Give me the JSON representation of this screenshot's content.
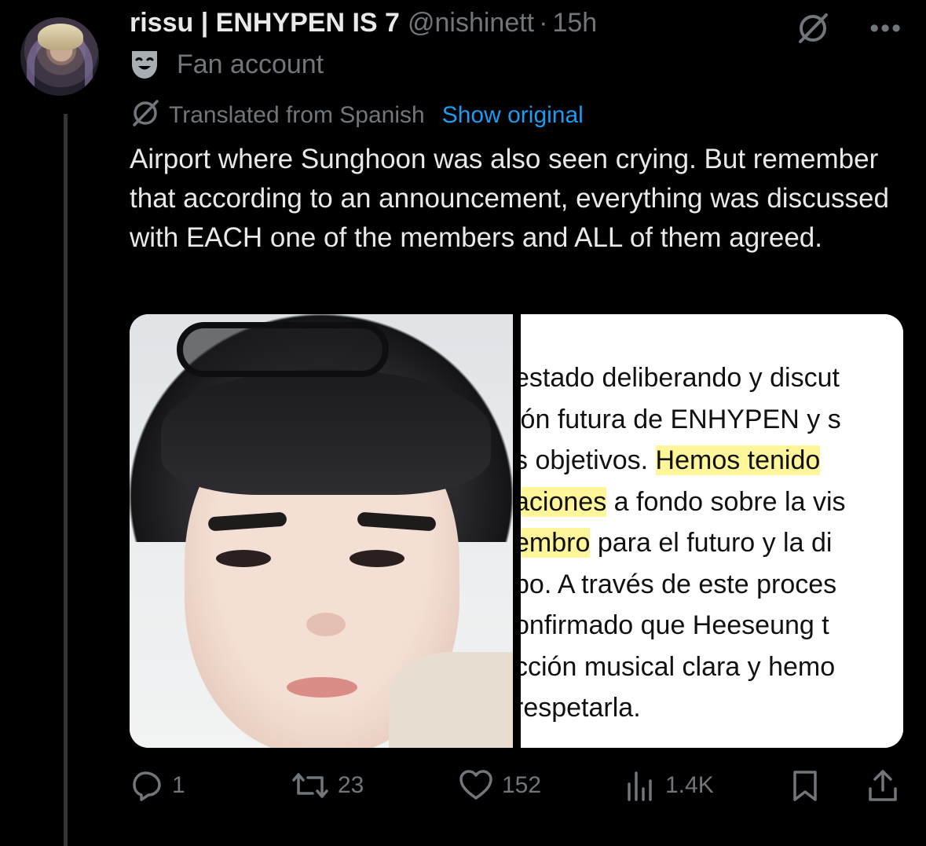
{
  "author": {
    "display_name": "rissu | ENHYPEN IS 7",
    "handle": "@nishinett",
    "separator": "·",
    "time": "15h",
    "label": "Fan account"
  },
  "header_icons": [
    "grok-icon",
    "more-icon"
  ],
  "translation": {
    "text": "Translated from Spanish",
    "show_original": "Show original"
  },
  "tweet_text": "Airport where Sunghoon was also seen crying. But remember that according to an announcement, everything was discussed with EACH one of the members and ALL of them agreed.",
  "media_text": {
    "lines": [
      [
        {
          "t": "estado deliberando y discut",
          "h": false
        }
      ],
      [
        {
          "t": "ión futura de ENHYPEN y s",
          "h": false
        }
      ],
      [
        {
          "t": "s objetivos. ",
          "h": false
        },
        {
          "t": "Hemos tenido",
          "h": true
        }
      ],
      [
        {
          "t": "aciones",
          "h": true
        },
        {
          "t": " a fondo sobre la vis",
          "h": false
        }
      ],
      [
        {
          "t": "embro",
          "h": true
        },
        {
          "t": " para el futuro y la di",
          "h": false
        }
      ],
      [
        {
          "t": "po. A través de este proces",
          "h": false
        }
      ],
      [
        {
          "t": "onfirmado que Heeseung t",
          "h": false
        }
      ],
      [
        {
          "t": "cción musical clara y hemo",
          "h": false
        }
      ],
      [
        {
          "t": " respetarla.",
          "h": false
        }
      ]
    ]
  },
  "actions": {
    "replies": "1",
    "reposts": "23",
    "likes": "152",
    "views": "1.4K"
  },
  "colors": {
    "background": "#000000",
    "text": "#e7e9ea",
    "muted": "#71767b",
    "link": "#1d9bf0",
    "highlight": "#fff59a"
  }
}
